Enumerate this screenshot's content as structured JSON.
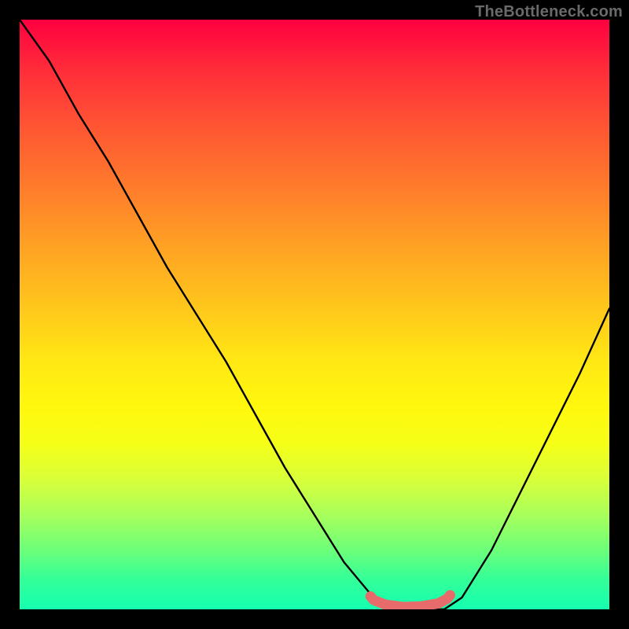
{
  "watermark": {
    "text": "TheBottleneck.com"
  },
  "chart_data": {
    "type": "line",
    "title": "",
    "xlabel": "",
    "ylabel": "",
    "xlim": [
      0,
      1
    ],
    "ylim": [
      0,
      1
    ],
    "series": [
      {
        "name": "curve",
        "x": [
          0.0,
          0.05,
          0.1,
          0.15,
          0.2,
          0.25,
          0.3,
          0.35,
          0.4,
          0.45,
          0.5,
          0.55,
          0.6,
          0.63,
          0.67,
          0.72,
          0.75,
          0.8,
          0.85,
          0.9,
          0.95,
          1.0
        ],
        "values": [
          1.0,
          0.93,
          0.84,
          0.76,
          0.67,
          0.58,
          0.5,
          0.42,
          0.33,
          0.24,
          0.16,
          0.08,
          0.02,
          0.0,
          0.0,
          0.0,
          0.02,
          0.1,
          0.2,
          0.3,
          0.4,
          0.51
        ]
      },
      {
        "name": "highlight",
        "x": [
          0.595,
          0.6,
          0.62,
          0.65,
          0.68,
          0.71,
          0.725,
          0.73
        ],
        "values": [
          0.022,
          0.016,
          0.008,
          0.004,
          0.005,
          0.01,
          0.018,
          0.024
        ]
      }
    ],
    "highlight_color": "#e76b6b",
    "curve_color": "#000000"
  }
}
